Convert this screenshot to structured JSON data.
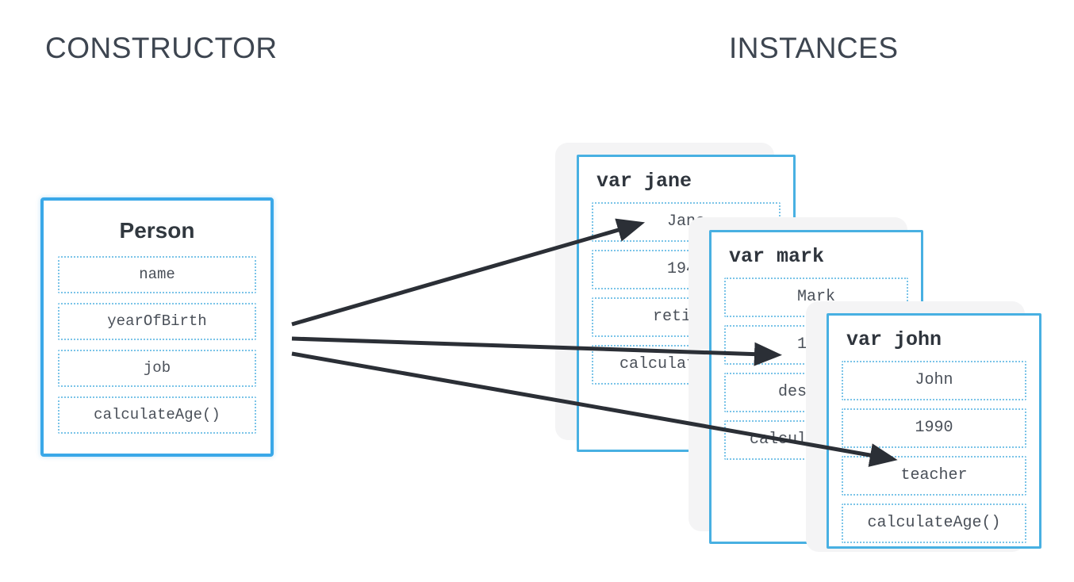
{
  "headings": {
    "constructor": "CONSTRUCTOR",
    "instances": "INSTANCES"
  },
  "constructor_box": {
    "title": "Person",
    "properties": [
      "name",
      "yearOfBirth",
      "job",
      "calculateAge()"
    ]
  },
  "instances": [
    {
      "title": "var jane",
      "properties": [
        "Jane",
        "1948",
        "retired",
        "calculateAge()"
      ]
    },
    {
      "title": "var mark",
      "properties": [
        "Mark",
        "1965",
        "designer",
        "calculateAge()"
      ]
    },
    {
      "title": "var john",
      "properties": [
        "John",
        "1990",
        "teacher",
        "calculateAge()"
      ]
    }
  ],
  "arrows": [
    {
      "name": "arrow-to-jane",
      "label": ""
    },
    {
      "name": "arrow-to-mark",
      "label": ""
    },
    {
      "name": "arrow-to-john",
      "label": ""
    }
  ],
  "colors": {
    "background": "#ffffff",
    "card_border": "#48b0e2",
    "constructor_border": "#3aa8e8",
    "row_dotted_border": "#7bc4e8",
    "heading_text": "#3d4550",
    "body_text": "#4a5059",
    "title_text": "#2f353d",
    "arrow": "#2b2f36",
    "card_shadow": "#f4f4f5"
  }
}
